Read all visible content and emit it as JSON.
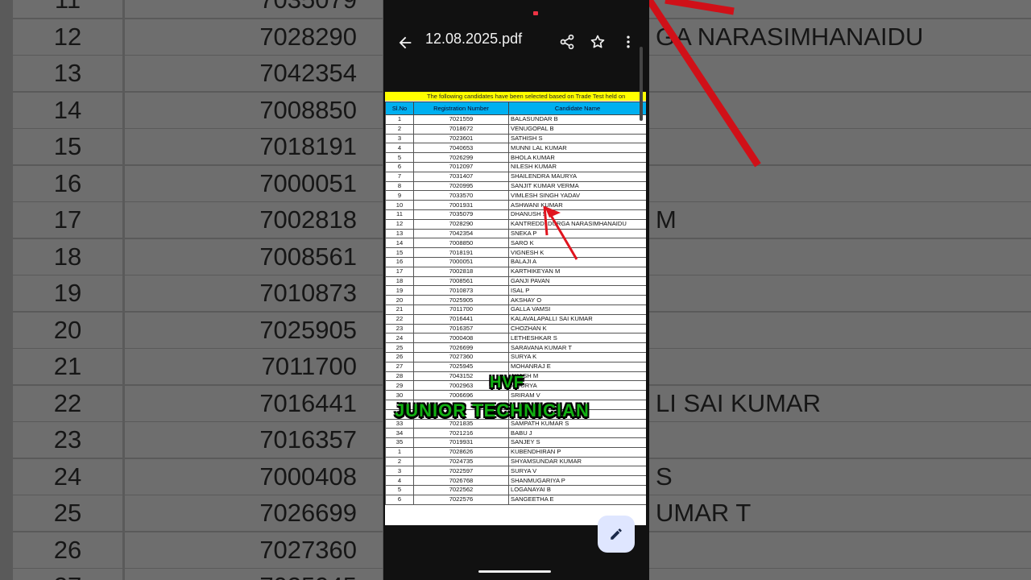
{
  "background": {
    "rows": [
      {
        "sl": "11",
        "reg": "7035079",
        "name": ""
      },
      {
        "sl": "12",
        "reg": "7028290",
        "name": "GA NARASIMHANAIDU"
      },
      {
        "sl": "13",
        "reg": "7042354",
        "name": ""
      },
      {
        "sl": "14",
        "reg": "7008850",
        "name": ""
      },
      {
        "sl": "15",
        "reg": "7018191",
        "name": ""
      },
      {
        "sl": "16",
        "reg": "7000051",
        "name": ""
      },
      {
        "sl": "17",
        "reg": "7002818",
        "name": "M"
      },
      {
        "sl": "18",
        "reg": "7008561",
        "name": ""
      },
      {
        "sl": "19",
        "reg": "7010873",
        "name": ""
      },
      {
        "sl": "20",
        "reg": "7025905",
        "name": ""
      },
      {
        "sl": "21",
        "reg": "7011700",
        "name": ""
      },
      {
        "sl": "22",
        "reg": "7016441",
        "name": "LI SAI KUMAR"
      },
      {
        "sl": "23",
        "reg": "7016357",
        "name": ""
      },
      {
        "sl": "24",
        "reg": "7000408",
        "name": "S"
      },
      {
        "sl": "25",
        "reg": "7026699",
        "name": "UMAR T"
      },
      {
        "sl": "26",
        "reg": "7027360",
        "name": ""
      },
      {
        "sl": "27",
        "reg": "7025945",
        "name": ""
      }
    ]
  },
  "appbar": {
    "title": "12.08.2025.pdf",
    "icons": [
      "back-arrow-icon",
      "share-icon",
      "star-icon",
      "more-vert-icon"
    ]
  },
  "document": {
    "banner": "The following  candidates have been selected based on Trade Test held on",
    "headers": {
      "sl": "Sl.No",
      "reg": "Registration Number",
      "name": "Candidate Name"
    },
    "rows": [
      {
        "sl": "1",
        "reg": "7021559",
        "name": "BALASUNDAR B"
      },
      {
        "sl": "2",
        "reg": "7018672",
        "name": "VENUGOPAL B"
      },
      {
        "sl": "3",
        "reg": "7023601",
        "name": "SATHISH S"
      },
      {
        "sl": "4",
        "reg": "7040653",
        "name": "MUNNI LAL KUMAR"
      },
      {
        "sl": "5",
        "reg": "7026299",
        "name": "BHOLA KUMAR"
      },
      {
        "sl": "6",
        "reg": "7012097",
        "name": "NILESH KUMAR"
      },
      {
        "sl": "7",
        "reg": "7031407",
        "name": "SHAILENDRA MAURYA"
      },
      {
        "sl": "8",
        "reg": "7020995",
        "name": "SANJIT KUMAR VERMA"
      },
      {
        "sl": "9",
        "reg": "7033570",
        "name": "VIMLESH SINGH YADAV"
      },
      {
        "sl": "10",
        "reg": "7001931",
        "name": "ASHWANI KUMAR"
      },
      {
        "sl": "11",
        "reg": "7035079",
        "name": "DHANUSH S"
      },
      {
        "sl": "12",
        "reg": "7028290",
        "name": "KANTREDDI DURGA NARASIMHANAIDU"
      },
      {
        "sl": "13",
        "reg": "7042354",
        "name": "SNEKA P"
      },
      {
        "sl": "14",
        "reg": "7008850",
        "name": "SARO K"
      },
      {
        "sl": "15",
        "reg": "7018191",
        "name": "VIGNESH K"
      },
      {
        "sl": "16",
        "reg": "7000051",
        "name": "BALAJI A"
      },
      {
        "sl": "17",
        "reg": "7002818",
        "name": "KARTHIKEYAN M"
      },
      {
        "sl": "18",
        "reg": "7008561",
        "name": "GANJI PAVAN"
      },
      {
        "sl": "19",
        "reg": "7010873",
        "name": "ISAL P"
      },
      {
        "sl": "20",
        "reg": "7025905",
        "name": "AKSHAY O"
      },
      {
        "sl": "21",
        "reg": "7011700",
        "name": "GALLA VAMSI"
      },
      {
        "sl": "22",
        "reg": "7016441",
        "name": "KALAVALAPALLI SAI KUMAR"
      },
      {
        "sl": "23",
        "reg": "7016357",
        "name": "CHOZHAN K"
      },
      {
        "sl": "24",
        "reg": "7000408",
        "name": "LETHESHKAR S"
      },
      {
        "sl": "25",
        "reg": "7026699",
        "name": "SARAVANA KUMAR T"
      },
      {
        "sl": "26",
        "reg": "7027360",
        "name": "SURYA K"
      },
      {
        "sl": "27",
        "reg": "7025945",
        "name": "MOHANRAJ E"
      },
      {
        "sl": "28",
        "reg": "7043152",
        "name": "AKASH M"
      },
      {
        "sl": "29",
        "reg": "7002963",
        "name": "MOURYA"
      },
      {
        "sl": "30",
        "reg": "7006696",
        "name": "SRIRAM V"
      },
      {
        "sl": "31",
        "reg": "",
        "name": ""
      },
      {
        "sl": "32",
        "reg": "",
        "name": ""
      },
      {
        "sl": "33",
        "reg": "7021835",
        "name": "SAMPATH KUMAR S"
      },
      {
        "sl": "34",
        "reg": "7021216",
        "name": "BABU J"
      },
      {
        "sl": "35",
        "reg": "7019931",
        "name": "SANJEY  S"
      },
      {
        "sl": "1",
        "reg": "7028626",
        "name": "KUBENDHIRAN P"
      },
      {
        "sl": "2",
        "reg": "7024735",
        "name": "SHYAMSUNDAR KUMAR"
      },
      {
        "sl": "3",
        "reg": "7022597",
        "name": "SURYA V"
      },
      {
        "sl": "4",
        "reg": "7026768",
        "name": "SHANMUGARIYA P"
      },
      {
        "sl": "5",
        "reg": "7022562",
        "name": "LOGANAYAI B"
      },
      {
        "sl": "6",
        "reg": "7022576",
        "name": "SANGEETHA E"
      }
    ]
  },
  "overlay": {
    "line1": "HVF",
    "line2": "JUNIOR TECHNICIAN"
  },
  "colors": {
    "banner": "#ffff00",
    "header": "#00b0f0",
    "overlay_text": "#12b012",
    "arrow": "#e0141e",
    "fab": "#dfe6ff"
  }
}
